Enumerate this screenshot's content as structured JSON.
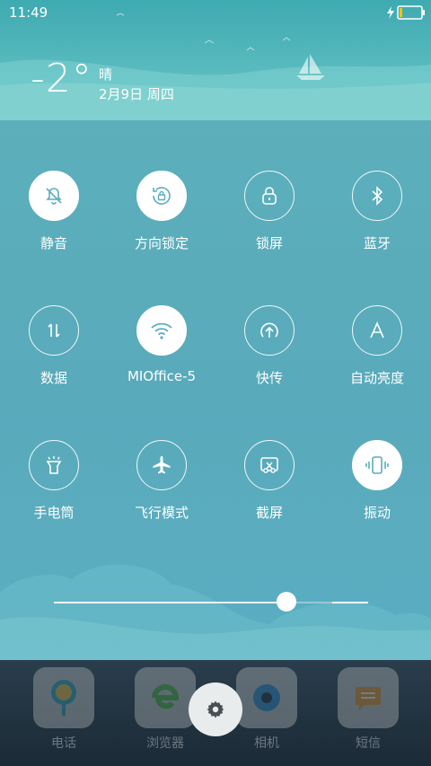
{
  "status": {
    "time": "11:49"
  },
  "weather": {
    "temperature": "-2°",
    "condition": "晴",
    "date": "2月9日 周四"
  },
  "toggles": [
    {
      "label": "静音",
      "icon": "bell-mute-icon",
      "on": true
    },
    {
      "label": "方向锁定",
      "icon": "rotation-lock-icon",
      "on": true
    },
    {
      "label": "锁屏",
      "icon": "lock-icon",
      "on": false
    },
    {
      "label": "蓝牙",
      "icon": "bluetooth-icon",
      "on": false
    },
    {
      "label": "数据",
      "icon": "mobile-data-icon",
      "on": false
    },
    {
      "label": "MIOffice-5",
      "icon": "wifi-icon",
      "on": true
    },
    {
      "label": "快传",
      "icon": "quick-transfer-icon",
      "on": false
    },
    {
      "label": "自动亮度",
      "icon": "auto-brightness-icon",
      "on": false
    },
    {
      "label": "手电筒",
      "icon": "flashlight-icon",
      "on": false
    },
    {
      "label": "飞行模式",
      "icon": "airplane-icon",
      "on": false
    },
    {
      "label": "截屏",
      "icon": "screenshot-icon",
      "on": false
    },
    {
      "label": "振动",
      "icon": "vibrate-icon",
      "on": true
    }
  ],
  "brightness": {
    "level": 0.74
  },
  "dock": [
    {
      "label": "电话",
      "icon": "phone-app-icon"
    },
    {
      "label": "浏览器",
      "icon": "browser-app-icon"
    },
    {
      "label": "相机",
      "icon": "camera-app-icon"
    },
    {
      "label": "短信",
      "icon": "messages-app-icon"
    }
  ],
  "colors": {
    "accent": "#5fb0bd",
    "active": "#ffffff",
    "active_icon": "#5aaebd"
  }
}
